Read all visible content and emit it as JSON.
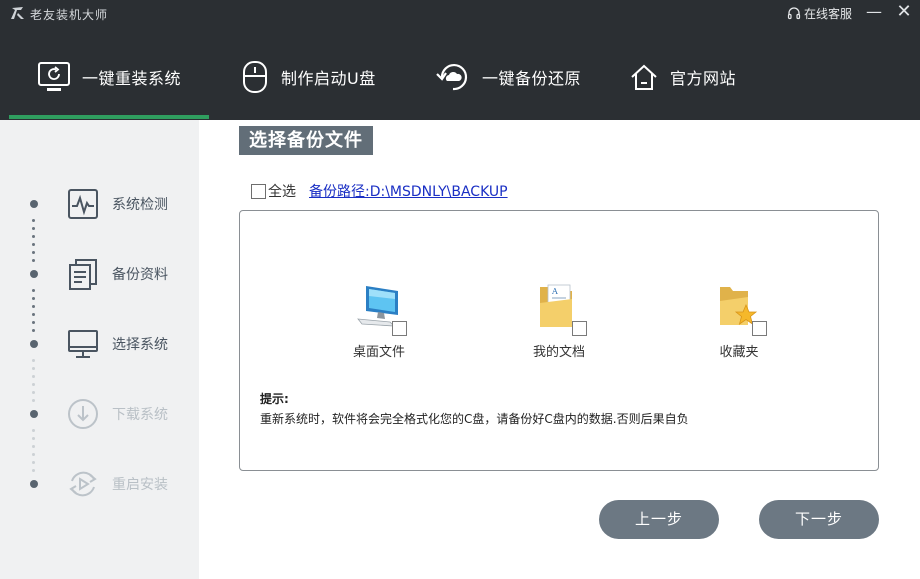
{
  "app": {
    "title": "老友装机大师",
    "service_label": "在线客服",
    "minimize_glyph": "—",
    "close_glyph": "✕"
  },
  "nav": {
    "items": [
      {
        "label": "一键重装系统",
        "icon": "monitor-refresh-icon",
        "active": true
      },
      {
        "label": "制作启动U盘",
        "icon": "usb-drive-icon",
        "active": false
      },
      {
        "label": "一键备份还原",
        "icon": "cloud-restore-icon",
        "active": false
      },
      {
        "label": "官方网站",
        "icon": "home-icon",
        "active": false
      }
    ],
    "active_color": "#2f9e5f"
  },
  "steps": [
    {
      "label": "系统检测",
      "icon": "heartbeat-monitor-icon",
      "state": "done"
    },
    {
      "label": "备份资料",
      "icon": "documents-icon",
      "state": "done"
    },
    {
      "label": "选择系统",
      "icon": "computer-icon",
      "state": "done"
    },
    {
      "label": "下载系统",
      "icon": "download-icon",
      "state": "pending"
    },
    {
      "label": "重启安装",
      "icon": "restart-icon",
      "state": "pending"
    }
  ],
  "main": {
    "section_title": "选择备份文件",
    "select_all_label": "全选",
    "backup_path": "备份路径:D:\\MSDNLY\\BACKUP",
    "folders": [
      {
        "label": "桌面文件",
        "icon": "desktop-computer-icon"
      },
      {
        "label": "我的文档",
        "icon": "my-documents-folder-icon"
      },
      {
        "label": "收藏夹",
        "icon": "favorites-folder-icon"
      }
    ],
    "tip_title": "提示:",
    "tip_text": "重新系统时，软件将会完全格式化您的C盘，请备份好C盘内的数据.否则后果自负"
  },
  "buttons": {
    "prev": "上一步",
    "next": "下一步"
  },
  "colors": {
    "header_bg": "#2b2f33",
    "sidebar_bg": "#f0f1f2",
    "button_bg": "#6c7883",
    "title_bg": "#626e78",
    "link": "#1a2fc4"
  }
}
